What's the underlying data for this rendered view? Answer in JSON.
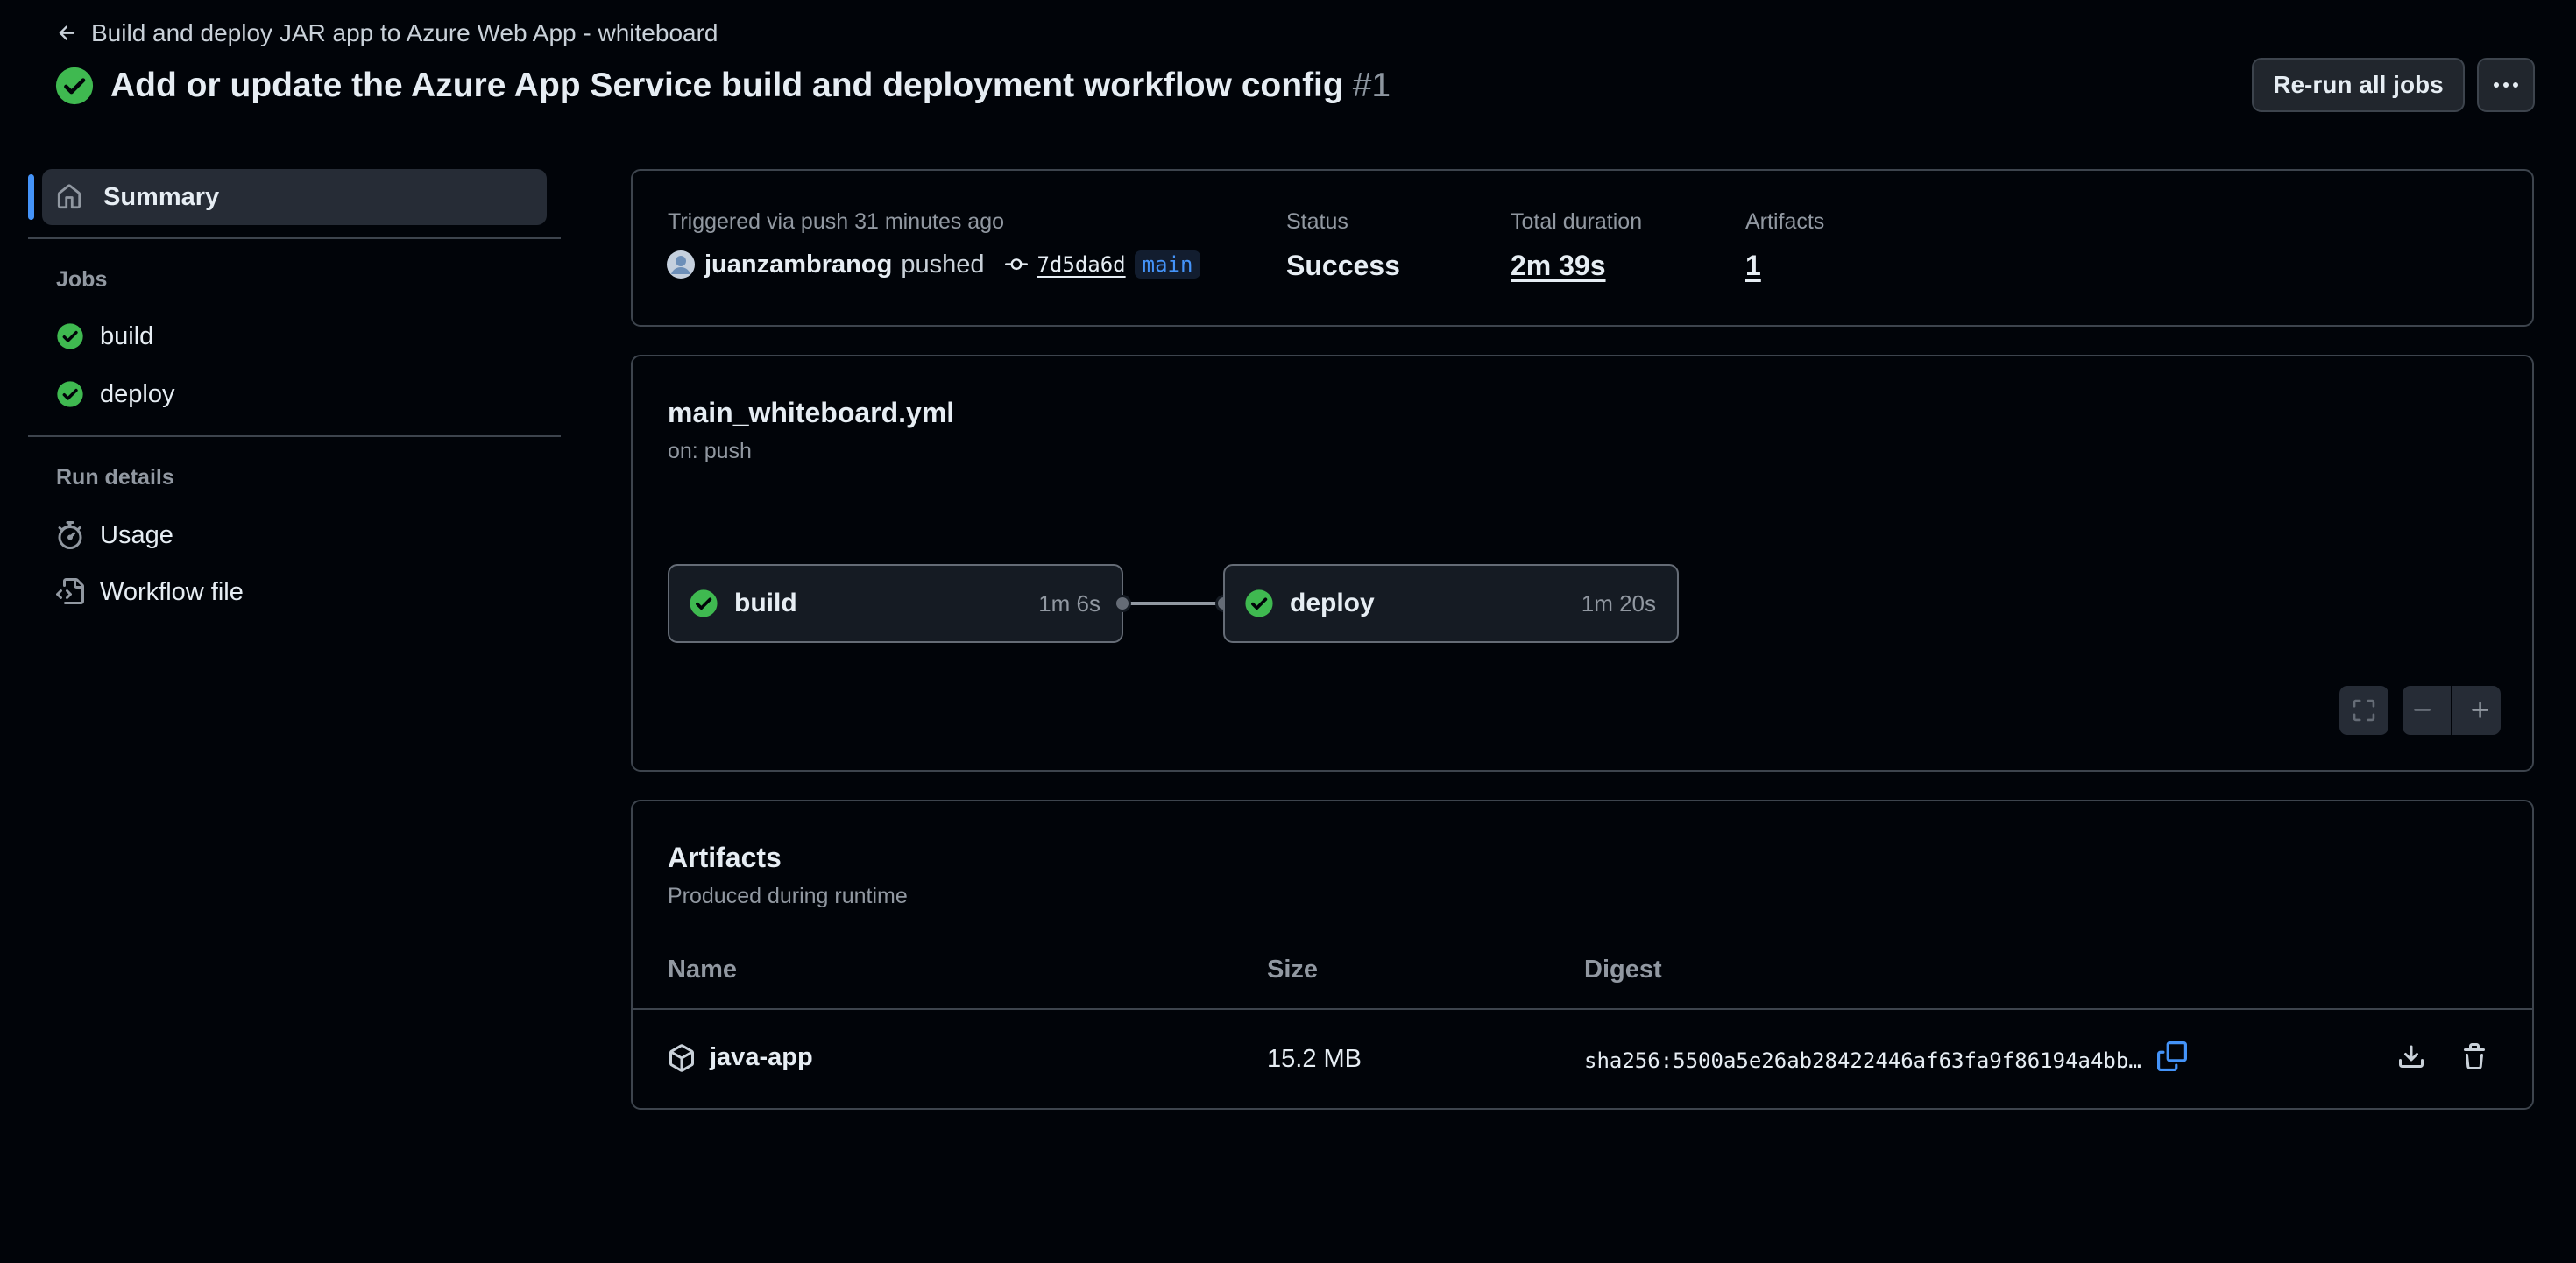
{
  "header": {
    "back_label": "Build and deploy JAR app to Azure Web App - whiteboard",
    "title": "Add or update the Azure App Service build and deployment workflow config",
    "run_number": "#1",
    "rerun_label": "Re-run all jobs"
  },
  "sidebar": {
    "summary_label": "Summary",
    "jobs_heading": "Jobs",
    "jobs": [
      {
        "label": "build",
        "status": "success"
      },
      {
        "label": "deploy",
        "status": "success"
      }
    ],
    "run_details_heading": "Run details",
    "run_details": [
      {
        "label": "Usage",
        "icon": "stopwatch-icon"
      },
      {
        "label": "Workflow file",
        "icon": "file-code-icon"
      }
    ]
  },
  "run_info": {
    "trigger": "Triggered via push 31 minutes ago",
    "actor": "juanzambranog",
    "action": "pushed",
    "commit": "7d5da6d",
    "branch": "main",
    "status_label": "Status",
    "status_value": "Success",
    "duration_label": "Total duration",
    "duration_value": "2m 39s",
    "artifacts_label": "Artifacts",
    "artifacts_value": "1"
  },
  "workflow": {
    "filename": "main_whiteboard.yml",
    "trigger": "on: push",
    "jobs": [
      {
        "name": "build",
        "duration": "1m 6s",
        "status": "success"
      },
      {
        "name": "deploy",
        "duration": "1m 20s",
        "status": "success"
      }
    ]
  },
  "artifacts": {
    "title": "Artifacts",
    "subtitle": "Produced during runtime",
    "columns": [
      "Name",
      "Size",
      "Digest"
    ],
    "rows": [
      {
        "name": "java-app",
        "size": "15.2 MB",
        "digest": "sha256:5500a5e26ab28422446af63fa9f86194a4bb…"
      }
    ]
  },
  "colors": {
    "background": "#010409",
    "border": "#3d444d",
    "success": "#3fb950",
    "accent": "#4493f8",
    "text": "#e6edf3",
    "muted": "#9198a1"
  }
}
